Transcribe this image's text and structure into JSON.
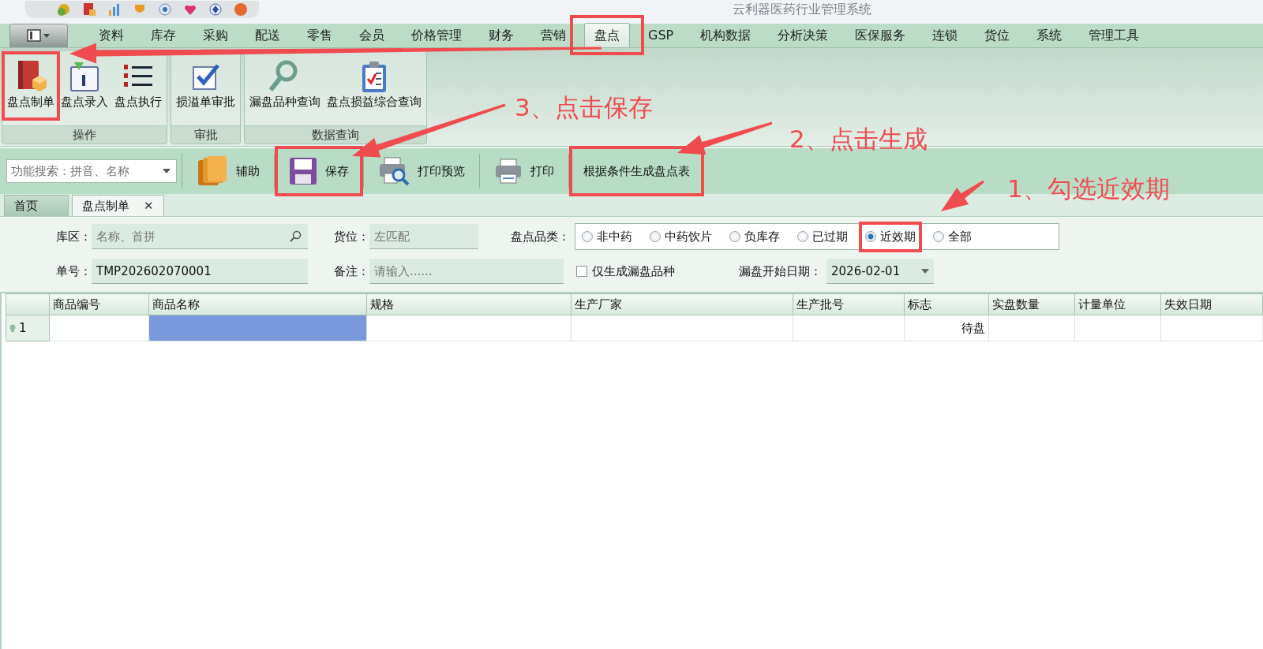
{
  "window": {
    "title": "云利器医药行业管理系统"
  },
  "menu_tabs": [
    {
      "label": "资料",
      "selected": false
    },
    {
      "label": "库存",
      "selected": false
    },
    {
      "label": "采购",
      "selected": false
    },
    {
      "label": "配送",
      "selected": false
    },
    {
      "label": "零售",
      "selected": false
    },
    {
      "label": "会员",
      "selected": false
    },
    {
      "label": "价格管理",
      "selected": false
    },
    {
      "label": "财务",
      "selected": false
    },
    {
      "label": "营销",
      "selected": false
    },
    {
      "label": "盘点",
      "selected": true
    },
    {
      "label": "GSP",
      "selected": false
    },
    {
      "label": "机构数据",
      "selected": false
    },
    {
      "label": "分析决策",
      "selected": false
    },
    {
      "label": "医保服务",
      "selected": false
    },
    {
      "label": "连锁",
      "selected": false
    },
    {
      "label": "货位",
      "selected": false
    },
    {
      "label": "系统",
      "selected": false
    },
    {
      "label": "管理工具",
      "selected": false
    }
  ],
  "ribbon_groups": [
    {
      "label": "操作",
      "buttons": [
        {
          "label": "盘点制单"
        },
        {
          "label": "盘点录入"
        },
        {
          "label": "盘点执行"
        }
      ]
    },
    {
      "label": "审批",
      "buttons": [
        {
          "label": "损溢单审批"
        }
      ]
    },
    {
      "label": "数据查询",
      "buttons": [
        {
          "label": "漏盘品种查询"
        },
        {
          "label": "盘点损益综合查询"
        }
      ]
    }
  ],
  "toolbar": {
    "search": {
      "placeholder": "功能搜索：拼音、名称"
    },
    "buttons": [
      {
        "label": "辅助"
      },
      {
        "label": "保存"
      },
      {
        "label": "打印预览"
      },
      {
        "label": "打印"
      },
      {
        "label": "根据条件生成盘点表"
      }
    ]
  },
  "doc_tabs": [
    {
      "label": "首页",
      "selected": false
    },
    {
      "label": "盘点制单",
      "selected": true,
      "close": "✕"
    }
  ],
  "form": {
    "warehouse": {
      "label": "库区：",
      "placeholder": "名称、首拼"
    },
    "location": {
      "label": "货位：",
      "placeholder": "左匹配"
    },
    "category": {
      "label": "盘点品类：",
      "options": [
        {
          "label": "非中药",
          "selected": false
        },
        {
          "label": "中药饮片",
          "selected": false
        },
        {
          "label": "负库存",
          "selected": false
        },
        {
          "label": "已过期",
          "selected": false
        },
        {
          "label": "近效期",
          "selected": true
        },
        {
          "label": "全部",
          "selected": false
        }
      ]
    },
    "number": {
      "label": "单号：",
      "value": "TMP202602070001"
    },
    "remark": {
      "label": "备注：",
      "placeholder": "请输入......"
    },
    "missing_only": {
      "label": "仅生成漏盘品种",
      "checked": false
    },
    "start_date": {
      "label": "漏盘开始日期：",
      "value": "2026-02-01"
    }
  },
  "grid": {
    "columns": [
      {
        "label": "商品编号",
        "selected": false
      },
      {
        "label": "商品名称",
        "selected": true
      },
      {
        "label": "规格",
        "selected": false
      },
      {
        "label": "生产厂家",
        "selected": false
      },
      {
        "label": "生产批号",
        "selected": false
      },
      {
        "label": "标志",
        "selected": false
      },
      {
        "label": "实盘数量",
        "selected": false
      },
      {
        "label": "计量单位",
        "selected": false
      },
      {
        "label": "失效日期",
        "selected": false
      }
    ],
    "rows": [
      {
        "row_number": "1",
        "flag": "待盘"
      }
    ]
  },
  "annotations": [
    {
      "text": "3、点击保存"
    },
    {
      "text": "2、点击生成"
    },
    {
      "text": "1、勾选近效期"
    }
  ]
}
